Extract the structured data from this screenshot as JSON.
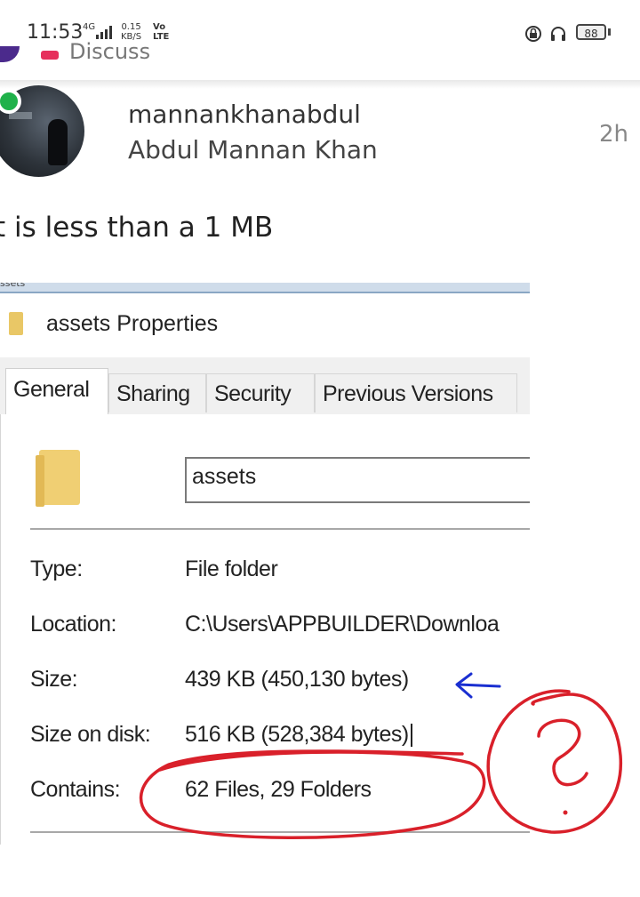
{
  "status_bar": {
    "time": "11:53",
    "network": "4G",
    "speed_value": "0.15",
    "speed_unit": "KB/S",
    "volte_top": "Vo",
    "volte_bottom": "LTE",
    "battery": "88"
  },
  "background_header": {
    "label": "Discuss"
  },
  "post": {
    "username": "mannankhanabdul",
    "display_name": "Abdul Mannan Khan",
    "time_ago": "2h",
    "text": "t is less than a 1 MB"
  },
  "properties_dialog": {
    "top_text": "ssets",
    "title": "assets Properties",
    "tabs": [
      "General",
      "Sharing",
      "Security",
      "Previous Versions"
    ],
    "name_field_value": "assets",
    "rows": [
      {
        "label": "Type:",
        "value": "File folder"
      },
      {
        "label": "Location:",
        "value": "C:\\Users\\APPBUILDER\\Downloa"
      },
      {
        "label": "Size:",
        "value": "439 KB (450,130 bytes)"
      },
      {
        "label": "Size on disk:",
        "value": "516 KB (528,384 bytes)"
      },
      {
        "label": "Contains:",
        "value": "62 Files, 29 Folders"
      }
    ]
  },
  "annotations": {
    "question_mark": "?",
    "arrow_color": "#1a2fd1",
    "circle_color": "#d9202a"
  },
  "colors": {
    "online": "#1fb14a",
    "discuss_accent": "#e6305c"
  }
}
